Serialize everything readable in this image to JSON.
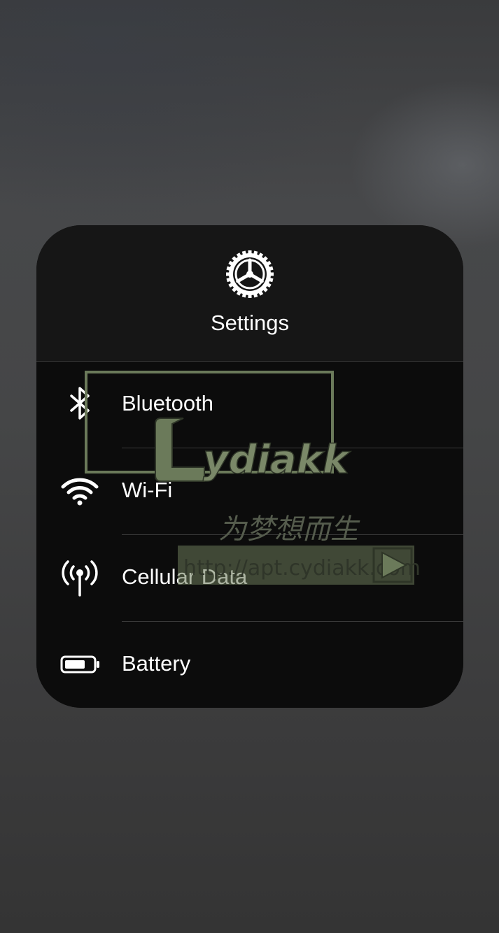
{
  "header": {
    "title": "Settings",
    "icon": "gear-icon"
  },
  "rows": [
    {
      "label": "Bluetooth",
      "icon": "bluetooth-icon"
    },
    {
      "label": "Wi-Fi",
      "icon": "wifi-icon"
    },
    {
      "label": "Cellular Data",
      "icon": "cellular-antenna-icon"
    },
    {
      "label": "Battery",
      "icon": "battery-icon"
    }
  ],
  "watermark": {
    "brand": "ydiakk",
    "tagline": "为梦想而生",
    "url": "http://apt.cydiakk.com"
  },
  "colors": {
    "card_background": "#121212",
    "text": "#ffffff",
    "divider": "#3a3a3a",
    "watermark": "#6b7a5a"
  }
}
